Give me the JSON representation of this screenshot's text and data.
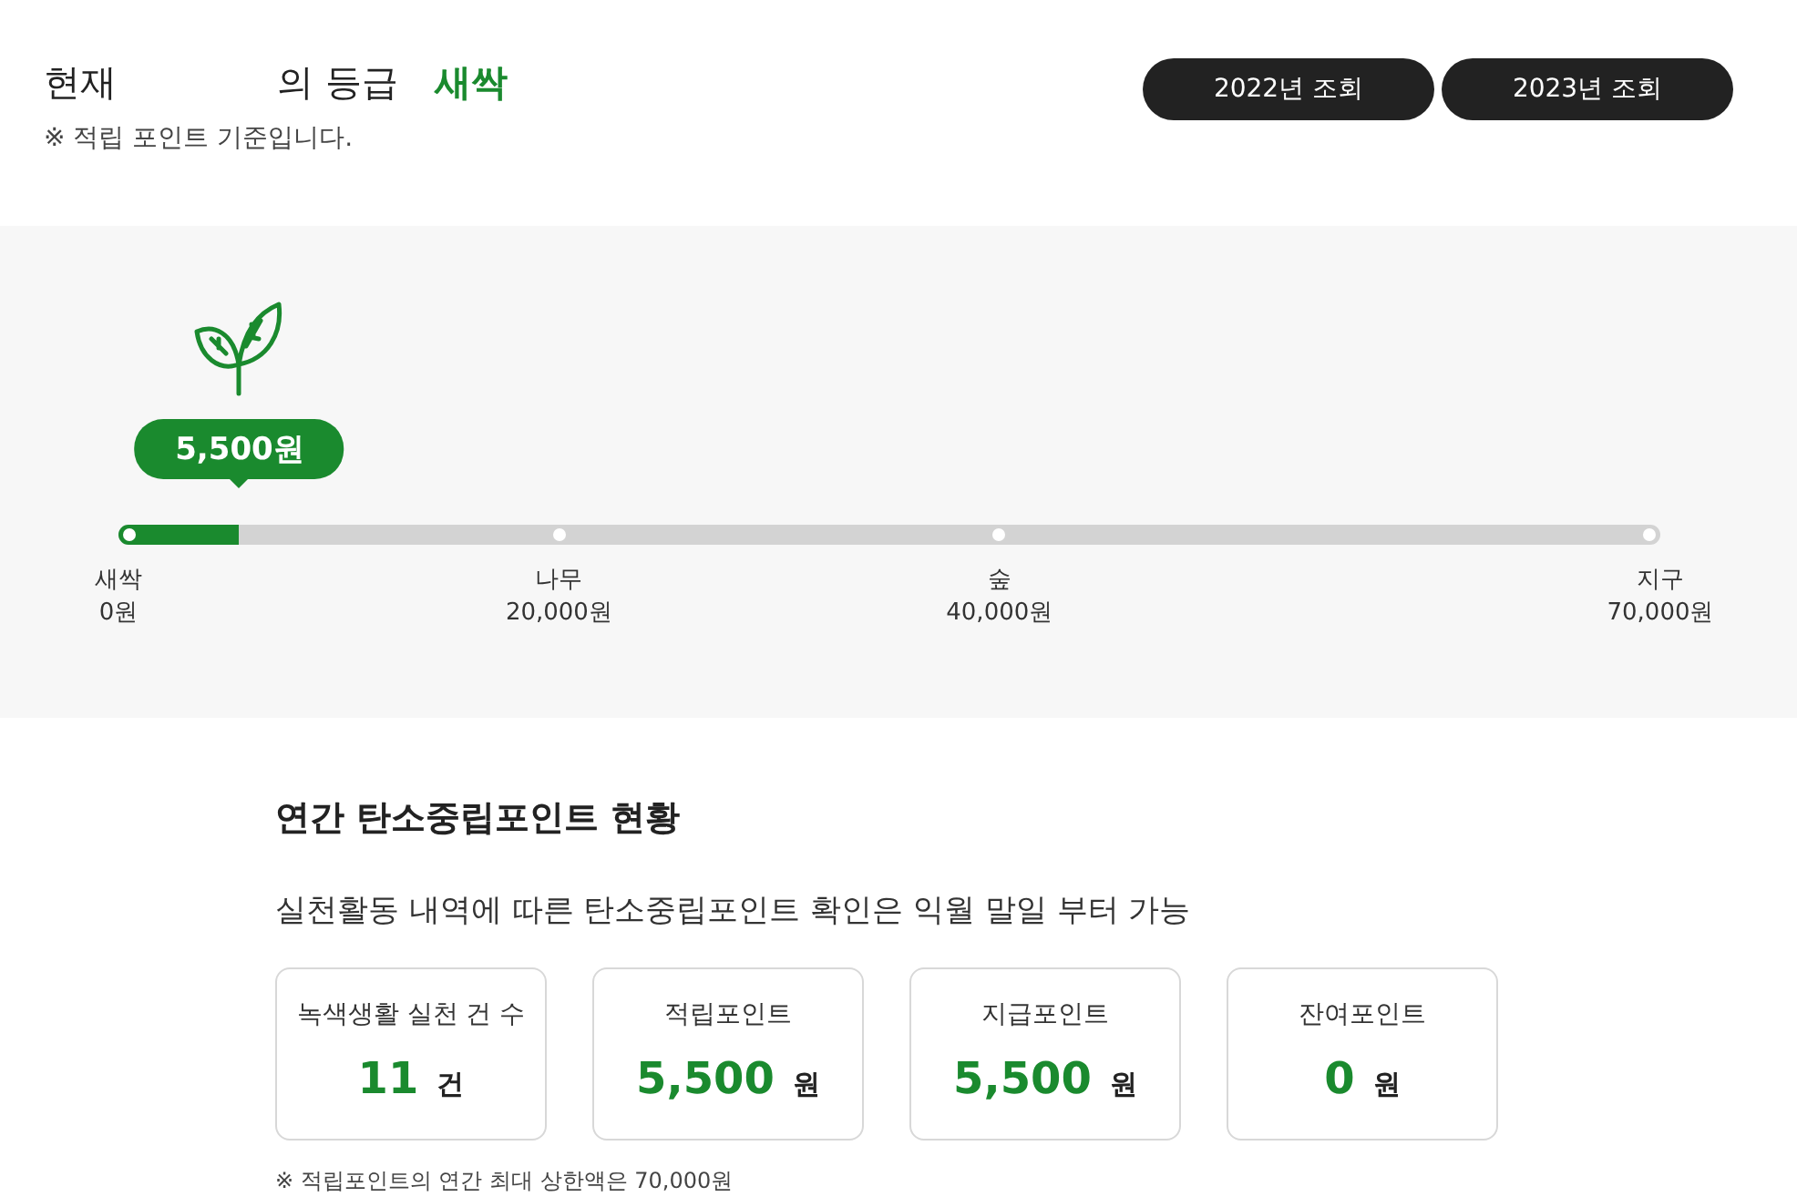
{
  "header": {
    "prefix": "현재",
    "suffix": "의 등급",
    "grade": "새싹",
    "note": "※ 적립 포인트 기준입니다."
  },
  "year_buttons": [
    {
      "label": "2022년 조회"
    },
    {
      "label": "2023년 조회"
    }
  ],
  "progress": {
    "amount": "5,500원",
    "level": 0.0786,
    "milestones": [
      {
        "name": "새싹",
        "value": "0원",
        "level": 0
      },
      {
        "name": "나무",
        "value": "20,000원",
        "level": 0.2857
      },
      {
        "name": "숲",
        "value": "40,000원",
        "level": 0.5714
      },
      {
        "name": "지구",
        "value": "70,000원",
        "level": 1
      }
    ]
  },
  "summary": {
    "title": "연간 탄소중립포인트 현황",
    "subtitle": "실천활동 내역에 따른 탄소중립포인트 확인은 익월 말일 부터 가능",
    "cards": [
      {
        "label": "녹색생활 실천 건 수",
        "value": "11",
        "unit": "건"
      },
      {
        "label": "적립포인트",
        "value": "5,500",
        "unit": "원"
      },
      {
        "label": "지급포인트",
        "value": "5,500",
        "unit": "원"
      },
      {
        "label": "잔여포인트",
        "value": "0",
        "unit": "원"
      }
    ],
    "footnote": "※ 적립포인트의 연간 최대 상한액은 70,000원"
  }
}
